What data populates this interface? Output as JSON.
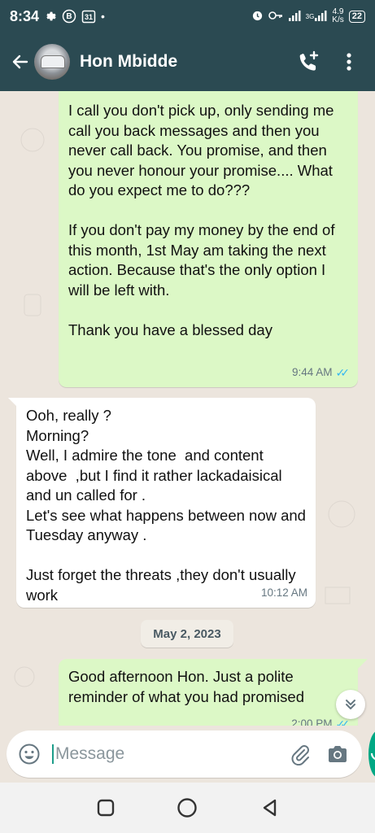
{
  "status_bar": {
    "time": "8:34",
    "badge_b": "B",
    "badge_cal": "31",
    "dot": "•",
    "network_gen": "3G",
    "net_speed_value": "4.9",
    "net_speed_unit": "K/s",
    "battery": "22"
  },
  "header": {
    "contact_name": "Hon Mbidde"
  },
  "messages": [
    {
      "direction": "outgoing",
      "text": "I call you don't pick up, only sending me call you back messages and then you never call back. You promise, and then you never honour your promise.... What do you expect me to do???\n\nIf you don't pay my money by the end of this month, 1st May am taking the next action. Because that's the only option I will be left with.\n\nThank you have a blessed day",
      "time": "9:44 AM",
      "ticks": "✓✓"
    },
    {
      "direction": "incoming",
      "text": "Ooh, really ?\nMorning?\nWell, I admire the tone  and content above  ,but I find it rather lackadaisical and un called for .\nLet's see what happens between now and Tuesday anyway .\n\nJust forget the threats ,they don't usually work",
      "time": "10:12 AM"
    },
    {
      "direction": "outgoing",
      "text": "Good afternoon Hon. Just a polite reminder of what you had promised",
      "time": "2:00 PM",
      "ticks": "✓✓"
    }
  ],
  "date_separator": "May 2, 2023",
  "composer": {
    "placeholder": "Message"
  },
  "colors": {
    "header_bg": "#2b4a52",
    "chat_bg": "#ece5dd",
    "outgoing_bubble": "#dcf8c6",
    "incoming_bubble": "#ffffff",
    "accent": "#00a884",
    "read_ticks": "#34b7f1"
  },
  "icons": {
    "status_settings": "gear-icon",
    "status_alarm": "alarm-icon",
    "status_key": "key-icon",
    "back": "arrow-left-icon",
    "add_call": "add-call-icon",
    "menu": "more-vert-icon",
    "emoji": "emoji-icon",
    "attach": "paperclip-icon",
    "camera": "camera-icon",
    "mic": "mic-icon",
    "scroll_down": "double-chevron-down-icon",
    "nav_recents": "square-icon",
    "nav_home": "circle-icon",
    "nav_back": "triangle-back-icon"
  }
}
